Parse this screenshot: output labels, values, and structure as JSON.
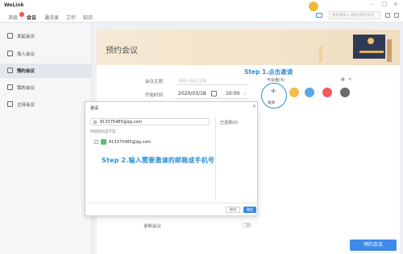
{
  "app": {
    "title": "WeLink"
  },
  "nav": {
    "tabs": [
      {
        "label": "消息"
      },
      {
        "label": "会议"
      },
      {
        "label": "通讯录"
      },
      {
        "label": "工作"
      },
      {
        "label": "知识"
      }
    ]
  },
  "header": {
    "search_placeholder": "搜索联系人/群组/服务号等"
  },
  "sidebar": {
    "items": [
      {
        "label": "发起会议",
        "icon": "video-icon"
      },
      {
        "label": "加入会议",
        "icon": "join-icon"
      },
      {
        "label": "预约会议",
        "icon": "calendar-icon"
      },
      {
        "label": "我的会议",
        "icon": "list-icon"
      },
      {
        "label": "主持会议",
        "icon": "host-icon"
      }
    ]
  },
  "page": {
    "title": "预约会议"
  },
  "form": {
    "subject_label": "会议主题",
    "subject_placeholder": "请输入会议主题",
    "start_label": "开始时间",
    "start_date": "2020/03/18",
    "start_time": "10:00",
    "record_label": "录制会议",
    "participants_label": "与会者(4)"
  },
  "invite": {
    "label": "邀请"
  },
  "annotations": {
    "step1": "Step 1.点击邀请",
    "step2": "Step 2.输入需要邀请的邮箱或手机号"
  },
  "dialog": {
    "title": "邀请",
    "search_value": "813375485@qq.com",
    "section_label": "你想找的是不是:",
    "result": "813375485@qq.com",
    "selected_label": "已选择(0)",
    "cancel_label": "取消",
    "ok_label": "确定"
  },
  "actions": {
    "submit_label": "预约会议"
  },
  "colors": {
    "accent": "#3d8ae8",
    "annotation": "#2a8fd8",
    "banner": "#f3e3c8"
  }
}
